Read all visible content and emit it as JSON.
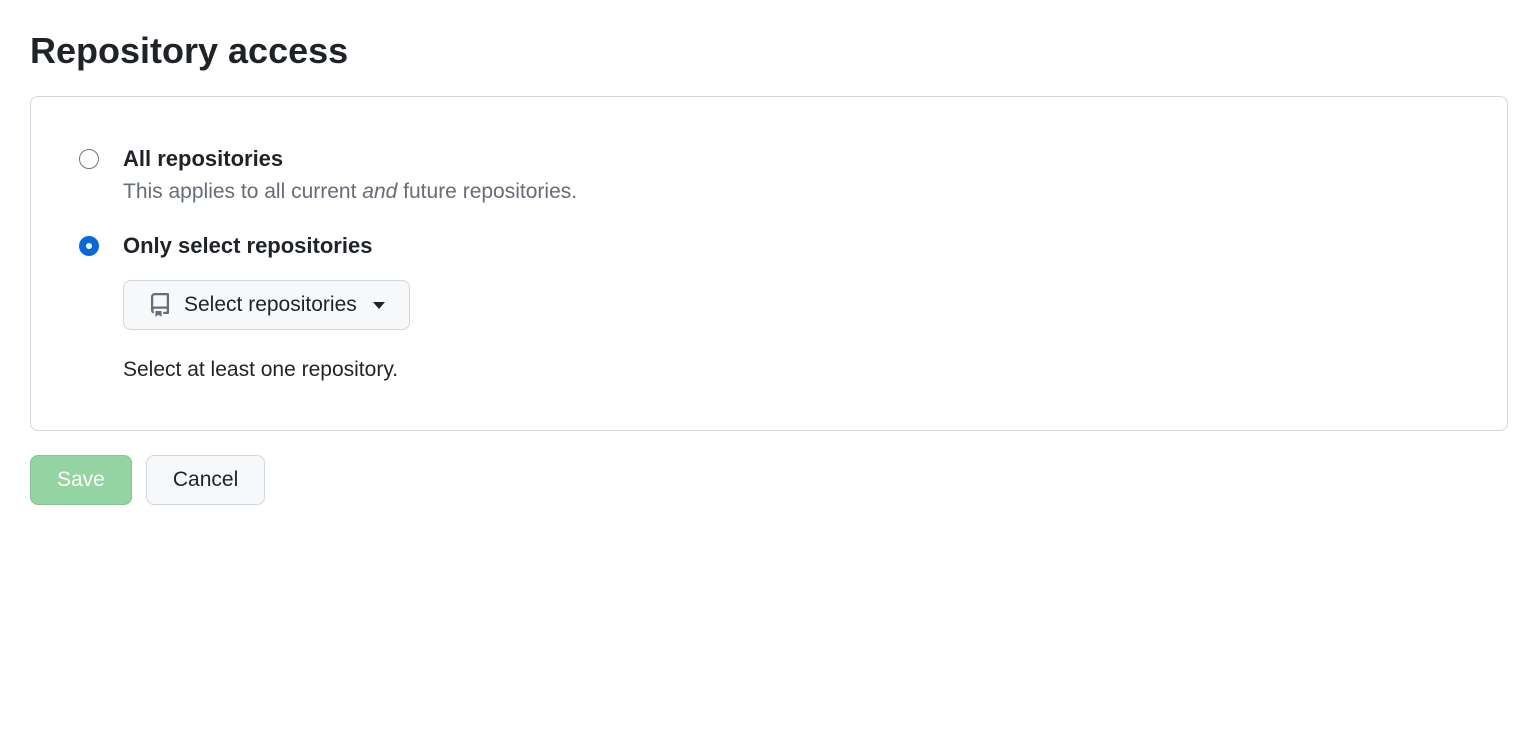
{
  "title": "Repository access",
  "options": {
    "all": {
      "label": "All repositories",
      "desc_prefix": "This applies to all current ",
      "desc_em": "and",
      "desc_suffix": " future repositories.",
      "selected": false
    },
    "select": {
      "label": "Only select repositories",
      "selected": true,
      "picker_label": "Select repositories",
      "helper": "Select at least one repository."
    }
  },
  "actions": {
    "save": "Save",
    "cancel": "Cancel"
  }
}
